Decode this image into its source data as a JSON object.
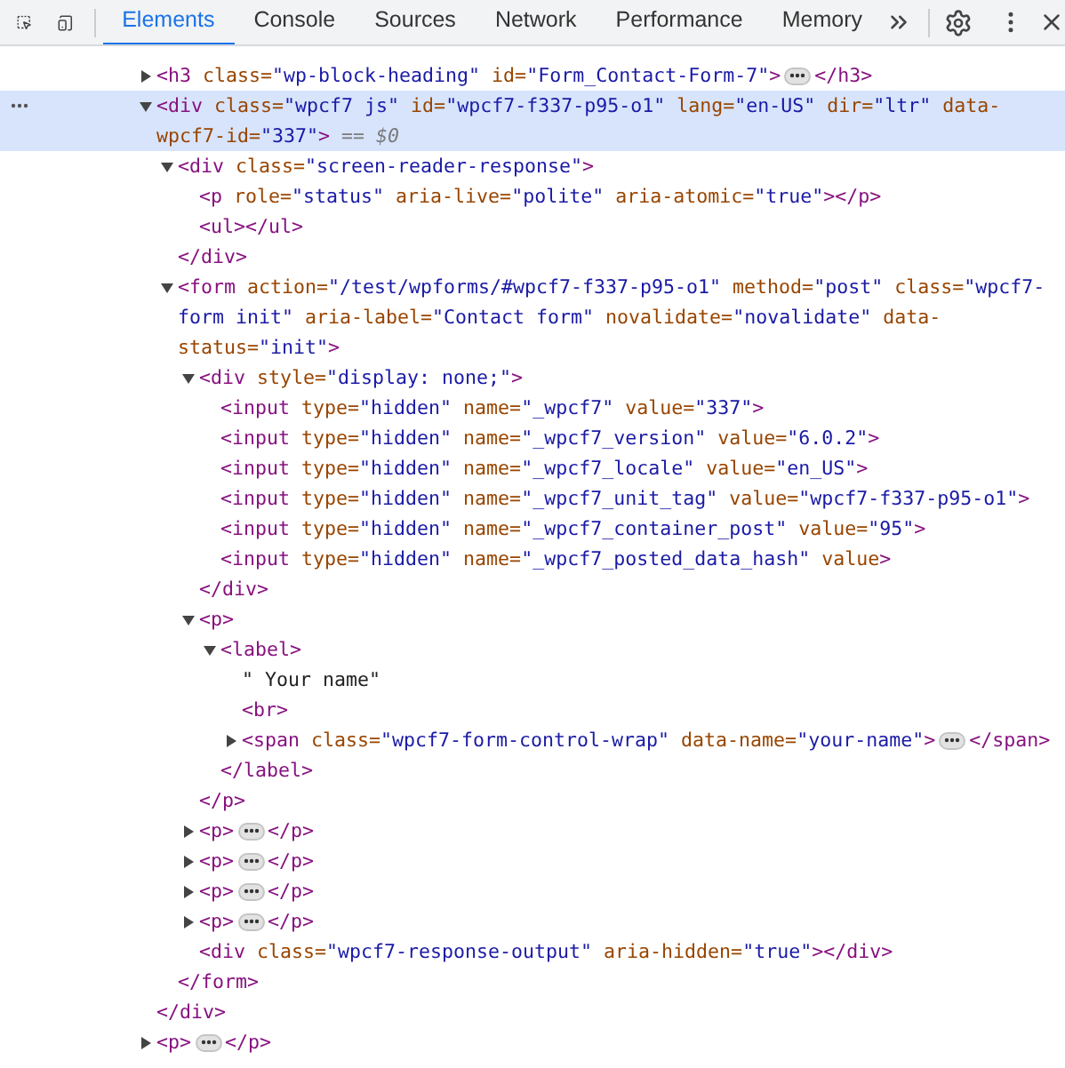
{
  "toolbar": {
    "tabs": [
      {
        "label": "Elements",
        "selected": true
      },
      {
        "label": "Console",
        "selected": false
      },
      {
        "label": "Sources",
        "selected": false
      },
      {
        "label": "Network",
        "selected": false
      },
      {
        "label": "Performance",
        "selected": false
      },
      {
        "label": "Memory",
        "selected": false
      }
    ]
  },
  "dom": [
    {
      "open": [
        {
          "kind": "tag",
          "text": "<h3"
        },
        {
          "kind": "attr",
          "text": " class="
        },
        {
          "kind": "value",
          "text": "\"wp-block-heading\""
        },
        {
          "kind": "attr",
          "text": " id="
        },
        {
          "kind": "value",
          "text": "\"Form_Contact-Form-7\""
        },
        {
          "kind": "tag",
          "text": ">"
        }
      ],
      "expanded": false,
      "close": [
        {
          "kind": "tag",
          "text": "</h3>"
        }
      ],
      "selected": false
    },
    {
      "open": [
        {
          "kind": "tag",
          "text": "<div"
        },
        {
          "kind": "attr",
          "text": " class="
        },
        {
          "kind": "value",
          "text": "\"wpcf7 js\""
        },
        {
          "kind": "attr",
          "text": " id="
        },
        {
          "kind": "value",
          "text": "\"wpcf7-f337-p95-o1\""
        },
        {
          "kind": "attr",
          "text": " lang="
        },
        {
          "kind": "value",
          "text": "\"en-US\""
        },
        {
          "kind": "attr",
          "text": " dir="
        },
        {
          "kind": "value",
          "text": "\"ltr\""
        },
        {
          "kind": "attr",
          "text": " data-wpcf7-id="
        },
        {
          "kind": "value",
          "text": "\"337\""
        },
        {
          "kind": "tag",
          "text": ">"
        },
        {
          "kind": "ref",
          "text": " == $0"
        }
      ],
      "expanded": true,
      "selected": true,
      "children": [
        {
          "open": [
            {
              "kind": "tag",
              "text": "<div"
            },
            {
              "kind": "attr",
              "text": " class="
            },
            {
              "kind": "value",
              "text": "\"screen-reader-response\""
            },
            {
              "kind": "tag",
              "text": ">"
            }
          ],
          "expanded": true,
          "selected": false,
          "children": [
            {
              "open": [
                {
                  "kind": "tag",
                  "text": "<p"
                },
                {
                  "kind": "attr",
                  "text": " role="
                },
                {
                  "kind": "value",
                  "text": "\"status\""
                },
                {
                  "kind": "attr",
                  "text": " aria-live="
                },
                {
                  "kind": "value",
                  "text": "\"polite\""
                },
                {
                  "kind": "attr",
                  "text": " aria-atomic="
                },
                {
                  "kind": "value",
                  "text": "\"true\""
                },
                {
                  "kind": "tag",
                  "text": "></p>"
                }
              ],
              "selected": false
            },
            {
              "open": [
                {
                  "kind": "tag",
                  "text": "<ul></ul>"
                }
              ],
              "selected": false
            }
          ],
          "close": [
            {
              "kind": "tag",
              "text": "</div>"
            }
          ]
        },
        {
          "open": [
            {
              "kind": "tag",
              "text": "<form"
            },
            {
              "kind": "attr",
              "text": " action="
            },
            {
              "kind": "value",
              "text": "\"/test/wpforms/#wpcf7-f337-p95-o1\""
            },
            {
              "kind": "attr",
              "text": " method="
            },
            {
              "kind": "value",
              "text": "\"post\""
            },
            {
              "kind": "attr",
              "text": " class="
            },
            {
              "kind": "value",
              "text": "\"wpcf7-form init\""
            },
            {
              "kind": "attr",
              "text": " aria-label="
            },
            {
              "kind": "value",
              "text": "\"Contact form\""
            },
            {
              "kind": "attr",
              "text": " novalidate="
            },
            {
              "kind": "value",
              "text": "\"novalidate\""
            },
            {
              "kind": "attr",
              "text": " data-status="
            },
            {
              "kind": "value",
              "text": "\"init\""
            },
            {
              "kind": "tag",
              "text": ">"
            }
          ],
          "expanded": true,
          "selected": false,
          "children": [
            {
              "open": [
                {
                  "kind": "tag",
                  "text": "<div"
                },
                {
                  "kind": "attr",
                  "text": " style="
                },
                {
                  "kind": "value",
                  "text": "\"display: none;\""
                },
                {
                  "kind": "tag",
                  "text": ">"
                }
              ],
              "expanded": true,
              "selected": false,
              "children": [
                {
                  "open": [
                    {
                      "kind": "tag",
                      "text": "<input"
                    },
                    {
                      "kind": "attr",
                      "text": " type="
                    },
                    {
                      "kind": "value",
                      "text": "\"hidden\""
                    },
                    {
                      "kind": "attr",
                      "text": " name="
                    },
                    {
                      "kind": "value",
                      "text": "\"_wpcf7\""
                    },
                    {
                      "kind": "attr",
                      "text": " value="
                    },
                    {
                      "kind": "value",
                      "text": "\"337\""
                    },
                    {
                      "kind": "tag",
                      "text": ">"
                    }
                  ],
                  "selected": false
                },
                {
                  "open": [
                    {
                      "kind": "tag",
                      "text": "<input"
                    },
                    {
                      "kind": "attr",
                      "text": " type="
                    },
                    {
                      "kind": "value",
                      "text": "\"hidden\""
                    },
                    {
                      "kind": "attr",
                      "text": " name="
                    },
                    {
                      "kind": "value",
                      "text": "\"_wpcf7_version\""
                    },
                    {
                      "kind": "attr",
                      "text": " value="
                    },
                    {
                      "kind": "value",
                      "text": "\"6.0.2\""
                    },
                    {
                      "kind": "tag",
                      "text": ">"
                    }
                  ],
                  "selected": false
                },
                {
                  "open": [
                    {
                      "kind": "tag",
                      "text": "<input"
                    },
                    {
                      "kind": "attr",
                      "text": " type="
                    },
                    {
                      "kind": "value",
                      "text": "\"hidden\""
                    },
                    {
                      "kind": "attr",
                      "text": " name="
                    },
                    {
                      "kind": "value",
                      "text": "\"_wpcf7_locale\""
                    },
                    {
                      "kind": "attr",
                      "text": " value="
                    },
                    {
                      "kind": "value",
                      "text": "\"en_US\""
                    },
                    {
                      "kind": "tag",
                      "text": ">"
                    }
                  ],
                  "selected": false
                },
                {
                  "open": [
                    {
                      "kind": "tag",
                      "text": "<input"
                    },
                    {
                      "kind": "attr",
                      "text": " type="
                    },
                    {
                      "kind": "value",
                      "text": "\"hidden\""
                    },
                    {
                      "kind": "attr",
                      "text": " name="
                    },
                    {
                      "kind": "value",
                      "text": "\"_wpcf7_unit_tag\""
                    },
                    {
                      "kind": "attr",
                      "text": " value="
                    },
                    {
                      "kind": "value",
                      "text": "\"wpcf7-f337-p95-o1\""
                    },
                    {
                      "kind": "tag",
                      "text": ">"
                    }
                  ],
                  "selected": false
                },
                {
                  "open": [
                    {
                      "kind": "tag",
                      "text": "<input"
                    },
                    {
                      "kind": "attr",
                      "text": " type="
                    },
                    {
                      "kind": "value",
                      "text": "\"hidden\""
                    },
                    {
                      "kind": "attr",
                      "text": " name="
                    },
                    {
                      "kind": "value",
                      "text": "\"_wpcf7_container_post\""
                    },
                    {
                      "kind": "attr",
                      "text": " value="
                    },
                    {
                      "kind": "value",
                      "text": "\"95\""
                    },
                    {
                      "kind": "tag",
                      "text": ">"
                    }
                  ],
                  "selected": false
                },
                {
                  "open": [
                    {
                      "kind": "tag",
                      "text": "<input"
                    },
                    {
                      "kind": "attr",
                      "text": " type="
                    },
                    {
                      "kind": "value",
                      "text": "\"hidden\""
                    },
                    {
                      "kind": "attr",
                      "text": " name="
                    },
                    {
                      "kind": "value",
                      "text": "\"_wpcf7_posted_data_hash\""
                    },
                    {
                      "kind": "attr",
                      "text": " value"
                    },
                    {
                      "kind": "tag",
                      "text": ">"
                    }
                  ],
                  "selected": false
                }
              ],
              "close": [
                {
                  "kind": "tag",
                  "text": "</div>"
                }
              ]
            },
            {
              "open": [
                {
                  "kind": "tag",
                  "text": "<p>"
                }
              ],
              "expanded": true,
              "selected": false,
              "children": [
                {
                  "open": [
                    {
                      "kind": "tag",
                      "text": "<label>"
                    }
                  ],
                  "expanded": true,
                  "selected": false,
                  "children": [
                    {
                      "open": [
                        {
                          "kind": "plain",
                          "text": "\" Your name\""
                        }
                      ],
                      "selected": false
                    },
                    {
                      "open": [
                        {
                          "kind": "tag",
                          "text": "<br>"
                        }
                      ],
                      "selected": false
                    },
                    {
                      "open": [
                        {
                          "kind": "tag",
                          "text": "<span"
                        },
                        {
                          "kind": "attr",
                          "text": " class="
                        },
                        {
                          "kind": "value",
                          "text": "\"wpcf7-form-control-wrap\""
                        },
                        {
                          "kind": "attr",
                          "text": " data-name="
                        },
                        {
                          "kind": "value",
                          "text": "\"your-name\""
                        },
                        {
                          "kind": "tag",
                          "text": ">"
                        }
                      ],
                      "expanded": false,
                      "close": [
                        {
                          "kind": "tag",
                          "text": "</span>"
                        }
                      ],
                      "selected": false
                    }
                  ],
                  "close": [
                    {
                      "kind": "tag",
                      "text": "</label>"
                    }
                  ]
                }
              ],
              "close": [
                {
                  "kind": "tag",
                  "text": "</p>"
                }
              ]
            },
            {
              "open": [
                {
                  "kind": "tag",
                  "text": "<p>"
                }
              ],
              "expanded": false,
              "close": [
                {
                  "kind": "tag",
                  "text": "</p>"
                }
              ],
              "selected": false
            },
            {
              "open": [
                {
                  "kind": "tag",
                  "text": "<p>"
                }
              ],
              "expanded": false,
              "close": [
                {
                  "kind": "tag",
                  "text": "</p>"
                }
              ],
              "selected": false
            },
            {
              "open": [
                {
                  "kind": "tag",
                  "text": "<p>"
                }
              ],
              "expanded": false,
              "close": [
                {
                  "kind": "tag",
                  "text": "</p>"
                }
              ],
              "selected": false
            },
            {
              "open": [
                {
                  "kind": "tag",
                  "text": "<p>"
                }
              ],
              "expanded": false,
              "close": [
                {
                  "kind": "tag",
                  "text": "</p>"
                }
              ],
              "selected": false
            },
            {
              "open": [
                {
                  "kind": "tag",
                  "text": "<div"
                },
                {
                  "kind": "attr",
                  "text": " class="
                },
                {
                  "kind": "value",
                  "text": "\"wpcf7-response-output\""
                },
                {
                  "kind": "attr",
                  "text": " aria-hidden="
                },
                {
                  "kind": "value",
                  "text": "\"true\""
                },
                {
                  "kind": "tag",
                  "text": "></div>"
                }
              ],
              "selected": false
            }
          ],
          "close": [
            {
              "kind": "tag",
              "text": "</form>"
            }
          ]
        }
      ],
      "close": [
        {
          "kind": "tag",
          "text": "</div>"
        }
      ]
    },
    {
      "open": [
        {
          "kind": "tag",
          "text": "<p>"
        }
      ],
      "expanded": false,
      "close": [
        {
          "kind": "tag",
          "text": "</p>"
        }
      ],
      "selected": false
    }
  ]
}
